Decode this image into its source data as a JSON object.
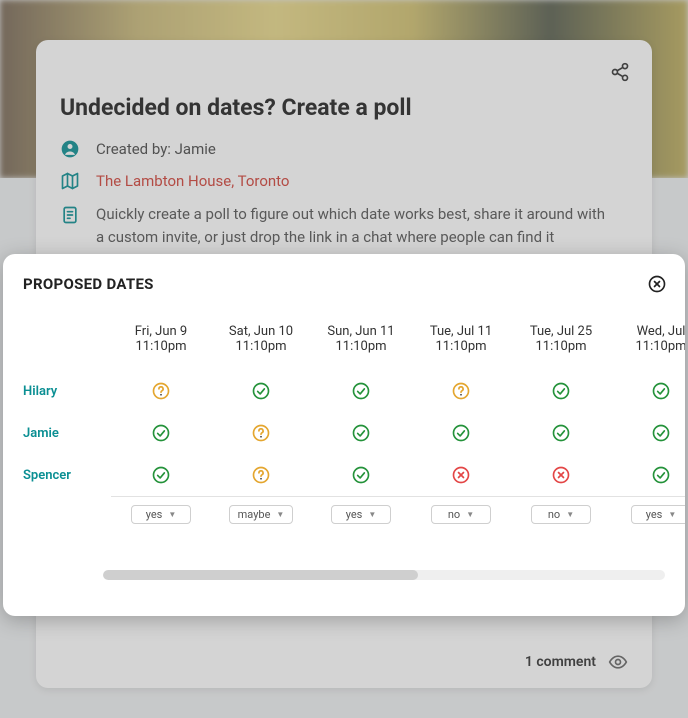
{
  "card": {
    "title": "Undecided on dates? Create a poll",
    "created_by_label": "Created by: Jamie",
    "location": "The Lambton House, Toronto",
    "description": "Quickly create a poll to figure out which date works best, share it around with a custom invite, or just drop the link in a chat where people can find it",
    "comment_count_label": "1 comment"
  },
  "modal": {
    "title": "PROPOSED DATES",
    "columns": [
      {
        "date": "Fri, Jun 9",
        "time": "11:10pm"
      },
      {
        "date": "Sat, Jun 10",
        "time": "11:10pm"
      },
      {
        "date": "Sun, Jun 11",
        "time": "11:10pm"
      },
      {
        "date": "Tue, Jul 11",
        "time": "11:10pm"
      },
      {
        "date": "Tue, Jul 25",
        "time": "11:10pm"
      },
      {
        "date": "Wed, Jul",
        "time": "11:10pm"
      }
    ],
    "rows": [
      {
        "name": "Hilary",
        "votes": [
          "maybe",
          "yes",
          "yes",
          "maybe",
          "yes",
          "yes"
        ]
      },
      {
        "name": "Jamie",
        "votes": [
          "yes",
          "maybe",
          "yes",
          "yes",
          "yes",
          "yes"
        ]
      },
      {
        "name": "Spencer",
        "votes": [
          "yes",
          "maybe",
          "yes",
          "no",
          "no",
          "yes"
        ]
      }
    ],
    "selectors": [
      "yes",
      "maybe",
      "yes",
      "no",
      "no",
      "yes"
    ]
  }
}
